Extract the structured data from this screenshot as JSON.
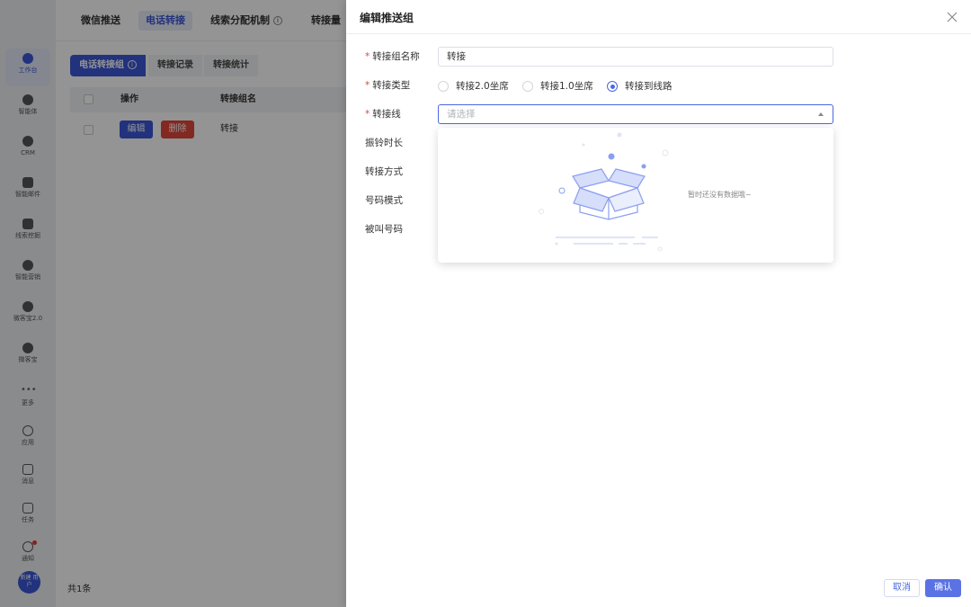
{
  "rail": {
    "items": [
      {
        "label": "工作台",
        "icon": "workbench-icon"
      },
      {
        "label": "智能体",
        "icon": "agent-icon"
      },
      {
        "label": "CRM",
        "icon": "crm-icon"
      },
      {
        "label": "智能邮件",
        "icon": "mail-icon"
      },
      {
        "label": "线索挖掘",
        "icon": "leads-icon"
      },
      {
        "label": "智能营销",
        "icon": "marketing-icon"
      },
      {
        "label": "微客宝2.0",
        "icon": "wechat-assistant-icon"
      },
      {
        "label": "微客宝",
        "icon": "wechat-icon"
      },
      {
        "label": "更多",
        "icon": "more-icon"
      },
      {
        "label": "应用",
        "icon": "app-icon"
      },
      {
        "label": "消息",
        "icon": "message-icon"
      },
      {
        "label": "任务",
        "icon": "task-icon"
      },
      {
        "label": "通知",
        "icon": "bell-icon"
      }
    ],
    "avatar_text": "新建 用户"
  },
  "topnav": {
    "items": [
      "微信推送",
      "电话转接",
      "线索分配机制",
      "转接量"
    ],
    "active": "电话转接"
  },
  "subtabs": {
    "items": [
      "电话转接组",
      "转接记录",
      "转接统计"
    ]
  },
  "table": {
    "headers": [
      "操作",
      "转接组名"
    ],
    "rows": [
      {
        "edit": "编辑",
        "delete": "删除",
        "name": "转接"
      }
    ],
    "total": "共1条"
  },
  "drawer": {
    "title": "编辑推送组",
    "fields": {
      "group_name": {
        "label": "转接组名称",
        "value": "转接",
        "required": "*"
      },
      "type": {
        "label": "转接类型",
        "required": "*",
        "options": [
          "转接2.0坐席",
          "转接1.0坐席",
          "转接到线路"
        ],
        "selected": "转接到线路"
      },
      "line": {
        "label": "转接线",
        "placeholder": "请选择",
        "required": "*"
      },
      "ring_duration": {
        "label": "振铃时长"
      },
      "method": {
        "label": "转接方式"
      },
      "number_mode": {
        "label": "号码模式"
      },
      "called_number": {
        "label": "被叫号码"
      }
    },
    "dropdown": {
      "empty_text": "暂时还没有数据哦~"
    },
    "buttons": {
      "cancel": "取消",
      "ok": "确认"
    }
  },
  "colors": {
    "primary": "#4a68e0",
    "danger": "#e0473a",
    "required": "#e0473a"
  }
}
